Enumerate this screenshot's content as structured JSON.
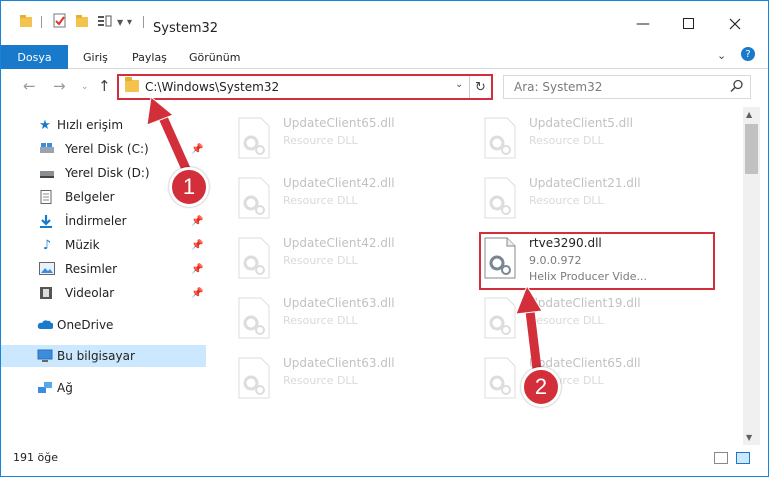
{
  "window": {
    "title": "System32"
  },
  "ribbon": {
    "tabs": [
      "Dosya",
      "Giriş",
      "Paylaş",
      "Görünüm"
    ]
  },
  "address": {
    "path": "C:\\Windows\\System32",
    "search_placeholder": "Ara: System32"
  },
  "sidebar": {
    "quick_access": "Hızlı erişim",
    "items": [
      {
        "label": "Yerel Disk (C:)",
        "icon": "drive-icon",
        "pinned": true
      },
      {
        "label": "Yerel Disk (D:)",
        "icon": "drive-icon",
        "pinned": false
      },
      {
        "label": "Belgeler",
        "icon": "documents-icon",
        "pinned": true
      },
      {
        "label": "İndirmeler",
        "icon": "downloads-icon",
        "pinned": true
      },
      {
        "label": "Müzik",
        "icon": "music-icon",
        "pinned": true
      },
      {
        "label": "Resimler",
        "icon": "pictures-icon",
        "pinned": true
      },
      {
        "label": "Videolar",
        "icon": "videos-icon",
        "pinned": true
      }
    ],
    "onedrive": "OneDrive",
    "this_pc": "Bu bilgisayar",
    "network": "Ağ"
  },
  "files": [
    {
      "name": "UpdateClient65.dll",
      "desc": "Resource DLL",
      "faded": true
    },
    {
      "name": "UpdateClient5.dll",
      "desc": "Resource DLL",
      "faded": true
    },
    {
      "name": "UpdateClient42.dll",
      "desc": "Resource DLL",
      "faded": true
    },
    {
      "name": "UpdateClient21.dll",
      "desc": "Resource DLL",
      "faded": true
    },
    {
      "name": "UpdateClient42.dll",
      "desc": "Resource DLL",
      "faded": true
    },
    {
      "name": "rtve3290.dll",
      "desc": "9.0.0.972",
      "desc2": "Helix Producer Vide...",
      "faded": false
    },
    {
      "name": "UpdateClient63.dll",
      "desc": "Resource DLL",
      "faded": true
    },
    {
      "name": "UpdateClient19.dll",
      "desc": "Resource DLL",
      "faded": true
    },
    {
      "name": "UpdateClient63.dll",
      "desc": "Resource DLL",
      "faded": true
    },
    {
      "name": "UpdateClient65.dll",
      "desc": "Resource DLL",
      "faded": true
    }
  ],
  "status": {
    "count": "191 öğe"
  },
  "annotations": {
    "badge1": "1",
    "badge2": "2"
  },
  "colors": {
    "accent": "#1979ca",
    "highlight": "#d42d3b",
    "selected": "#cce8ff"
  }
}
